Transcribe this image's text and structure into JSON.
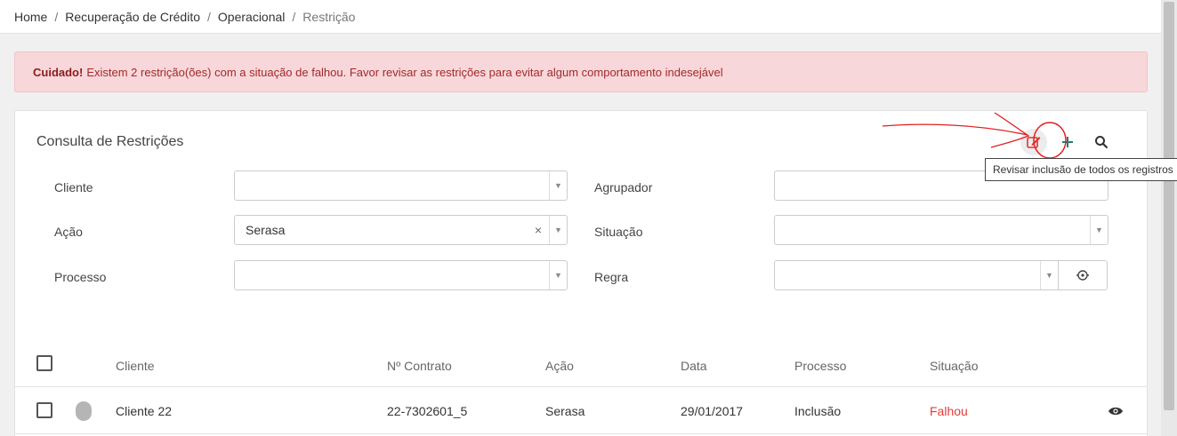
{
  "breadcrumb": [
    "Home",
    "Recuperação de Crédito",
    "Operacional",
    "Restrição"
  ],
  "alert": {
    "strong": "Cuidado!",
    "text": "Existem 2 restrição(ões) com a situação de falhou. Favor revisar as restrições para evitar algum comportamento indesejável"
  },
  "card": {
    "title": "Consulta de Restrições",
    "tooltip": "Revisar inclusão de todos os registros"
  },
  "filters": {
    "cliente_label": "Cliente",
    "cliente_value": "",
    "acao_label": "Ação",
    "acao_value": "Serasa",
    "processo_label": "Processo",
    "processo_value": "",
    "agrupador_label": "Agrupador",
    "agrupador_value": "",
    "situacao_label": "Situação",
    "situacao_value": "",
    "regra_label": "Regra",
    "regra_value": ""
  },
  "table": {
    "headers": [
      "Cliente",
      "Nº Contrato",
      "Ação",
      "Data",
      "Processo",
      "Situação"
    ],
    "rows": [
      {
        "cliente": "Cliente 22",
        "contrato": "22-7302601_5",
        "acao": "Serasa",
        "data": "29/01/2017",
        "processo": "Inclusão",
        "situacao": "Falhou"
      }
    ]
  },
  "icons": [
    "edit-icon",
    "plus-icon",
    "search-icon",
    "eye-icon",
    "view-target-icon",
    "chevron-down-icon",
    "clear-icon"
  ],
  "colors": {
    "alert_bg": "#f8d7da",
    "alert_text": "#a12a2a",
    "fail": "#e33b3b",
    "teal": "#2a7a6e",
    "annotation_red": "#e02020"
  }
}
